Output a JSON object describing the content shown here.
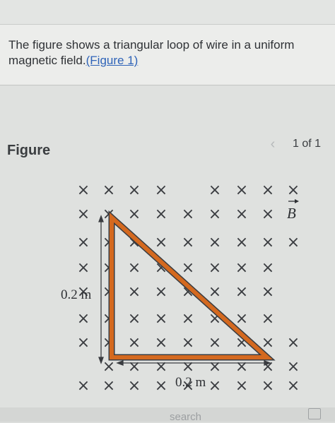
{
  "problem": {
    "text_before_link": "The figure shows a triangular loop of wire in a uniform magnetic field.",
    "link_text": "(Figure 1)"
  },
  "figure": {
    "title": "Figure",
    "pager_prev_icon": "chevron-left-icon",
    "pager_count": "1 of 1"
  },
  "diagram": {
    "field_symbol": "×",
    "field_label": "B",
    "vertical_side_label": "0.2 m",
    "horizontal_side_label": "0.2 m",
    "loop_color": "#d4691f",
    "line_color": "#3a3c40"
  },
  "footer": {
    "search_hint": "search",
    "toolbar_icon": "panel-icon"
  }
}
